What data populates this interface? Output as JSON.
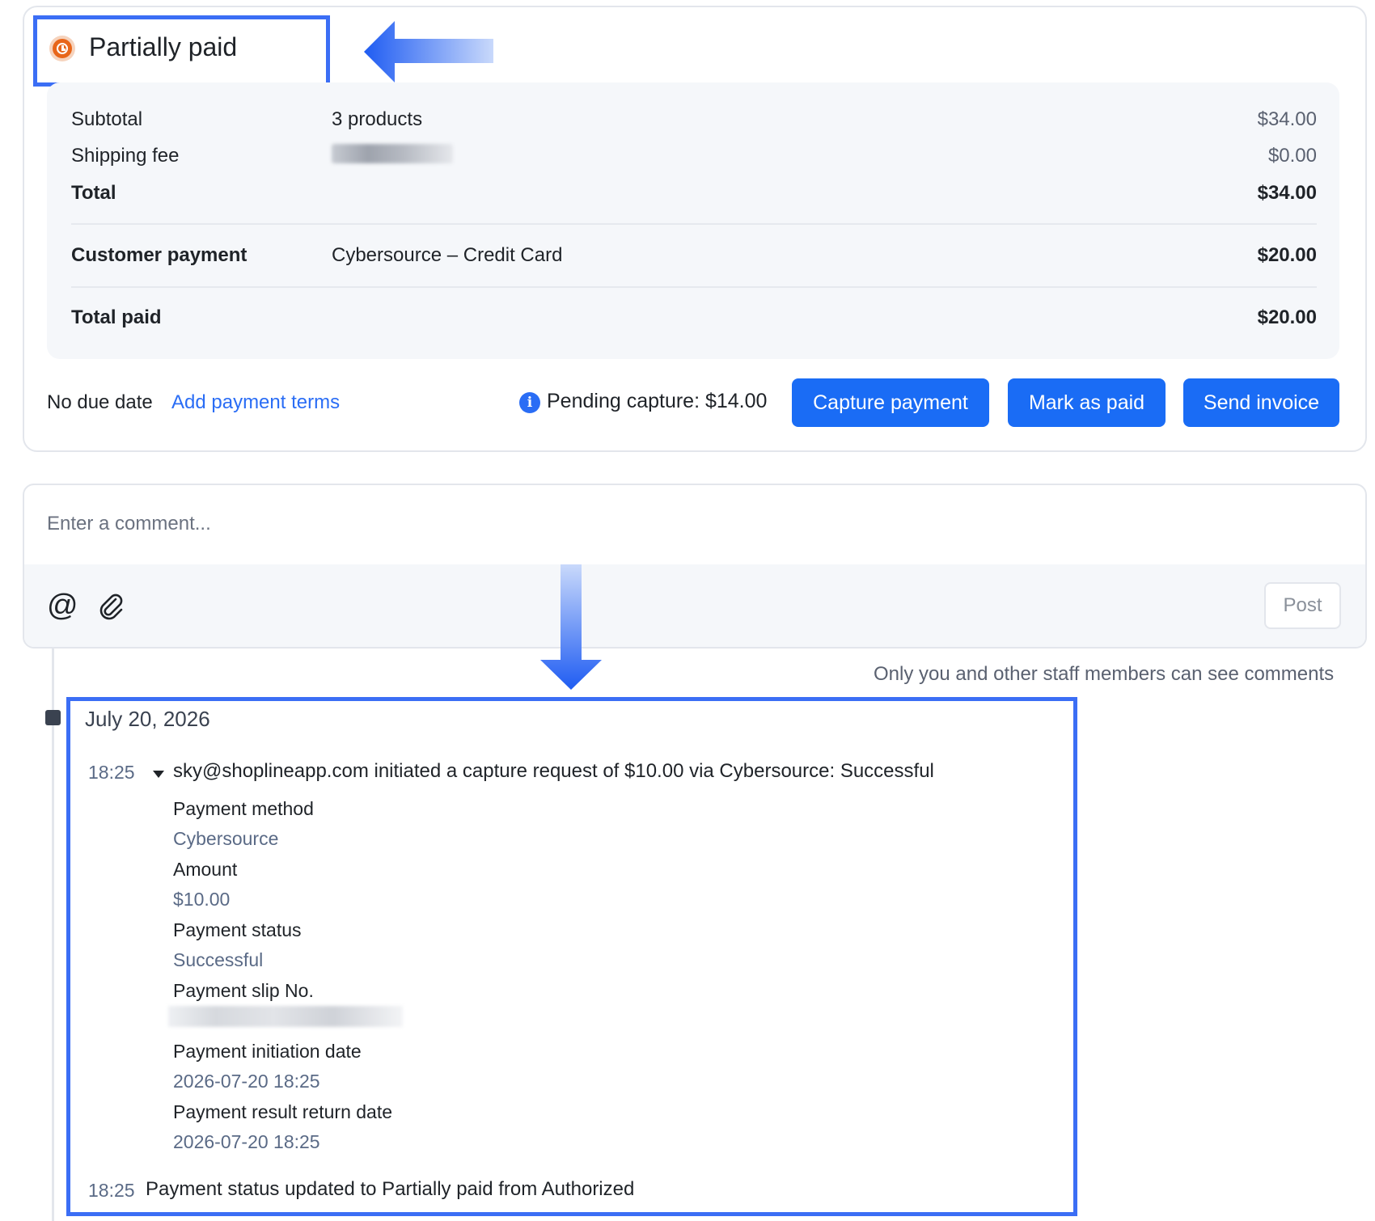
{
  "order_payment": {
    "status_label": "Partially paid",
    "subtotal_label": "Subtotal",
    "subtotal_detail": "3 products",
    "subtotal_amount": "$34.00",
    "shipping_label": "Shipping fee",
    "shipping_amount": "$0.00",
    "total_label": "Total",
    "total_amount": "$34.00",
    "customer_payment_label": "Customer payment",
    "customer_payment_method": "Cybersource – Credit Card",
    "customer_payment_amount": "$20.00",
    "total_paid_label": "Total paid",
    "total_paid_amount": "$20.00",
    "due_date_text": "No due date",
    "add_terms_link": "Add payment terms",
    "pending_capture_text": "Pending capture: $14.00",
    "buttons": {
      "capture": "Capture payment",
      "mark_paid": "Mark as paid",
      "send_invoice": "Send invoice"
    }
  },
  "comment": {
    "placeholder": "Enter a comment...",
    "post_label": "Post",
    "visibility_note": "Only you and other staff members can see comments"
  },
  "timeline": {
    "date": "July 20, 2026",
    "events": [
      {
        "time": "18:25",
        "text": "sky@shoplineapp.com initiated a capture request of $10.00 via Cybersource: Successful",
        "details": {
          "payment_method_label": "Payment method",
          "payment_method_value": "Cybersource",
          "amount_label": "Amount",
          "amount_value": "$10.00",
          "payment_status_label": "Payment status",
          "payment_status_value": "Successful",
          "slip_label": "Payment slip No.",
          "initiation_label": "Payment initiation date",
          "initiation_value": "2026-07-20 18:25",
          "result_label": "Payment result return date",
          "result_value": "2026-07-20 18:25"
        }
      },
      {
        "time": "18:25",
        "text": "Payment status updated to Partially paid from Authorized"
      }
    ]
  },
  "colors": {
    "primary_button": "#1a6cf5",
    "link": "#2a6df5",
    "status_icon": "#e8661a",
    "highlight_border": "#3b6ef5"
  },
  "icons": [
    "clock-icon",
    "info-icon",
    "at-mention-icon",
    "paperclip-icon",
    "caret-down-icon",
    "arrow-left-annotation",
    "arrow-down-annotation"
  ]
}
